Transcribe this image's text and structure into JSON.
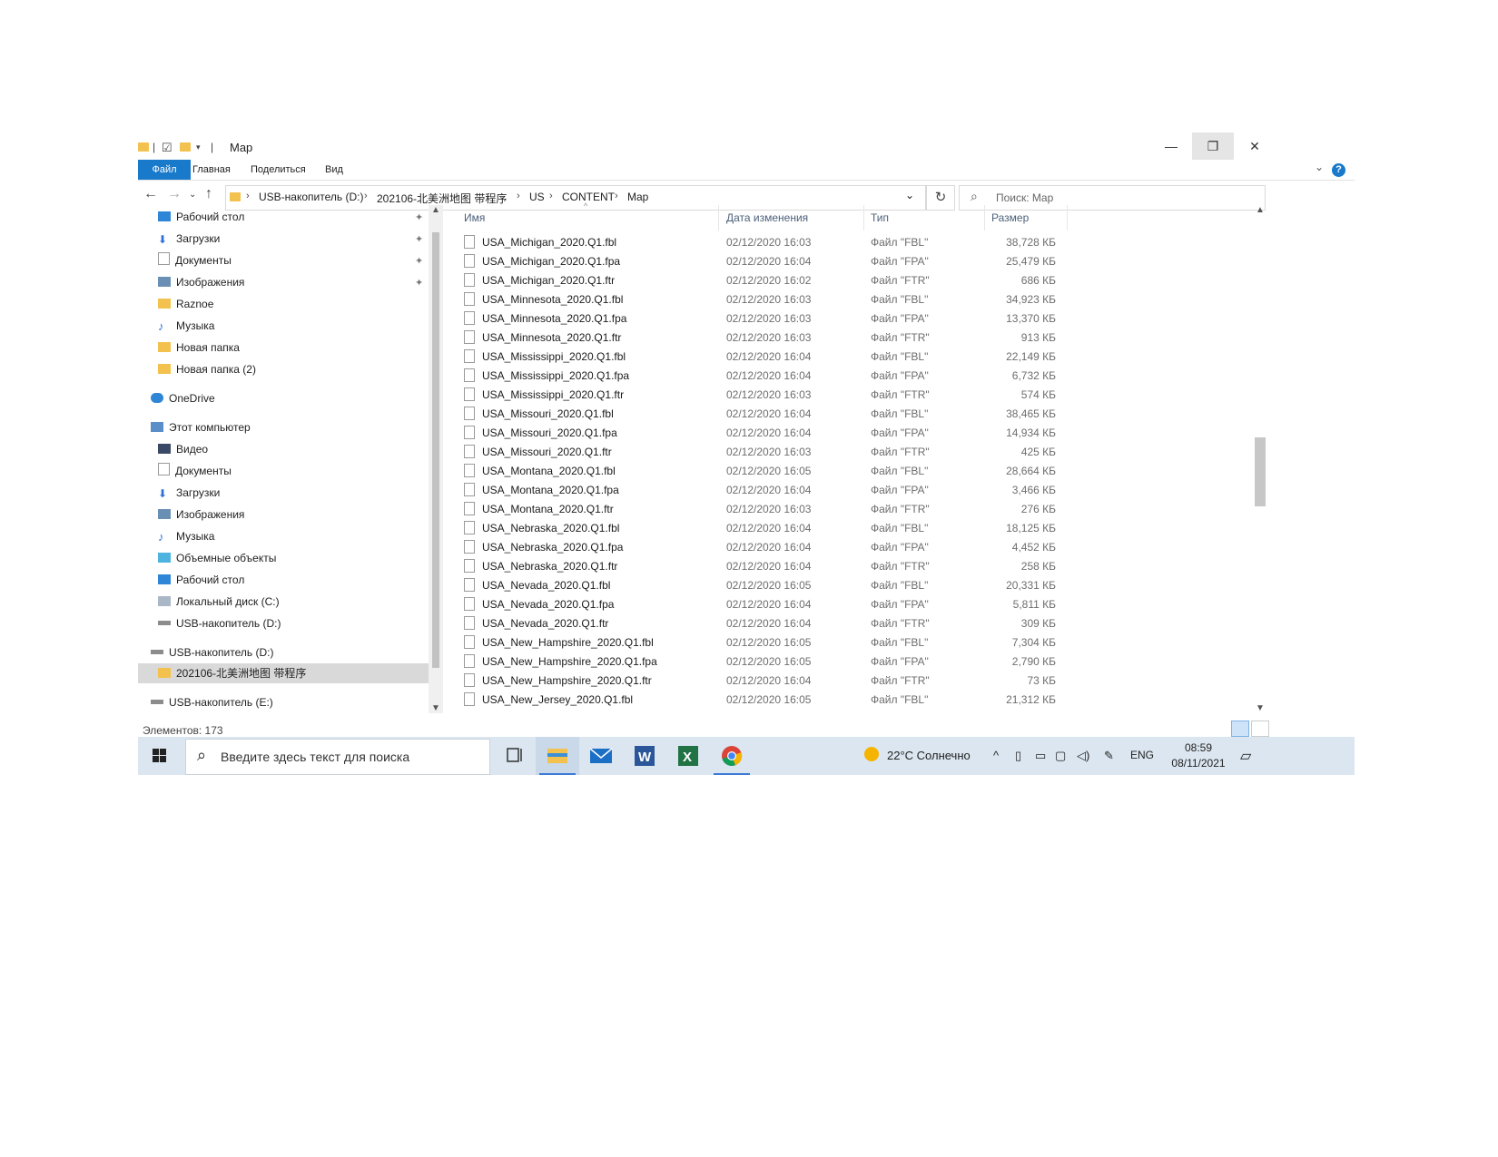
{
  "window": {
    "title": "Map",
    "buttons": {
      "minimize": "—",
      "restore": "❐",
      "close": "✕"
    }
  },
  "ribbon": {
    "tabs": [
      "Файл",
      "Главная",
      "Поделиться",
      "Вид"
    ],
    "help": "?"
  },
  "address": {
    "crumbs": [
      "USB-накопитель (D:)",
      "202106-北美洲地图 带程序",
      "US",
      "CONTENT",
      "Map"
    ]
  },
  "search": {
    "placeholder": "Поиск: Map"
  },
  "nav": {
    "quick_access": [
      {
        "label": "Рабочий стол",
        "icon": "desktop-icon",
        "pinned": true
      },
      {
        "label": "Загрузки",
        "icon": "download-icon",
        "pinned": true
      },
      {
        "label": "Документы",
        "icon": "documents-icon",
        "pinned": true
      },
      {
        "label": "Изображения",
        "icon": "pictures-icon",
        "pinned": true
      },
      {
        "label": "Raznoe",
        "icon": "folder-icon",
        "pinned": false
      },
      {
        "label": "Музыка",
        "icon": "music-icon",
        "pinned": false
      },
      {
        "label": "Новая папка",
        "icon": "folder-icon",
        "pinned": false
      },
      {
        "label": "Новая папка (2)",
        "icon": "folder-icon",
        "pinned": false
      }
    ],
    "onedrive": "OneDrive",
    "this_pc": "Этот компьютер",
    "pc_items": [
      {
        "label": "Видео",
        "icon": "video-icon"
      },
      {
        "label": "Документы",
        "icon": "documents-icon"
      },
      {
        "label": "Загрузки",
        "icon": "download-icon"
      },
      {
        "label": "Изображения",
        "icon": "pictures-icon"
      },
      {
        "label": "Музыка",
        "icon": "music-icon"
      },
      {
        "label": "Объемные объекты",
        "icon": "3d-objects-icon"
      },
      {
        "label": "Рабочий стол",
        "icon": "desktop-icon"
      },
      {
        "label": "Локальный диск (C:)",
        "icon": "disk-icon"
      },
      {
        "label": "USB-накопитель (D:)",
        "icon": "usb-drive-icon"
      }
    ],
    "usb_d": "USB-накопитель (D:)",
    "usb_d_child": "202106-北美洲地图 带程序",
    "usb_e": "USB-накопитель (E:)"
  },
  "list": {
    "columns": {
      "name": "Имя",
      "date": "Дата изменения",
      "type": "Тип",
      "size": "Размер"
    },
    "rows": [
      {
        "name": "USA_Michigan_2020.Q1.fbl",
        "date": "02/12/2020 16:03",
        "type": "Файл \"FBL\"",
        "size": "38,728 КБ"
      },
      {
        "name": "USA_Michigan_2020.Q1.fpa",
        "date": "02/12/2020 16:04",
        "type": "Файл \"FPA\"",
        "size": "25,479 КБ"
      },
      {
        "name": "USA_Michigan_2020.Q1.ftr",
        "date": "02/12/2020 16:02",
        "type": "Файл \"FTR\"",
        "size": "686 КБ"
      },
      {
        "name": "USA_Minnesota_2020.Q1.fbl",
        "date": "02/12/2020 16:03",
        "type": "Файл \"FBL\"",
        "size": "34,923 КБ"
      },
      {
        "name": "USA_Minnesota_2020.Q1.fpa",
        "date": "02/12/2020 16:03",
        "type": "Файл \"FPA\"",
        "size": "13,370 КБ"
      },
      {
        "name": "USA_Minnesota_2020.Q1.ftr",
        "date": "02/12/2020 16:03",
        "type": "Файл \"FTR\"",
        "size": "913 КБ"
      },
      {
        "name": "USA_Mississippi_2020.Q1.fbl",
        "date": "02/12/2020 16:04",
        "type": "Файл \"FBL\"",
        "size": "22,149 КБ"
      },
      {
        "name": "USA_Mississippi_2020.Q1.fpa",
        "date": "02/12/2020 16:04",
        "type": "Файл \"FPA\"",
        "size": "6,732 КБ"
      },
      {
        "name": "USA_Mississippi_2020.Q1.ftr",
        "date": "02/12/2020 16:03",
        "type": "Файл \"FTR\"",
        "size": "574 КБ"
      },
      {
        "name": "USA_Missouri_2020.Q1.fbl",
        "date": "02/12/2020 16:04",
        "type": "Файл \"FBL\"",
        "size": "38,465 КБ"
      },
      {
        "name": "USA_Missouri_2020.Q1.fpa",
        "date": "02/12/2020 16:04",
        "type": "Файл \"FPA\"",
        "size": "14,934 КБ"
      },
      {
        "name": "USA_Missouri_2020.Q1.ftr",
        "date": "02/12/2020 16:03",
        "type": "Файл \"FTR\"",
        "size": "425 КБ"
      },
      {
        "name": "USA_Montana_2020.Q1.fbl",
        "date": "02/12/2020 16:05",
        "type": "Файл \"FBL\"",
        "size": "28,664 КБ"
      },
      {
        "name": "USA_Montana_2020.Q1.fpa",
        "date": "02/12/2020 16:04",
        "type": "Файл \"FPA\"",
        "size": "3,466 КБ"
      },
      {
        "name": "USA_Montana_2020.Q1.ftr",
        "date": "02/12/2020 16:03",
        "type": "Файл \"FTR\"",
        "size": "276 КБ"
      },
      {
        "name": "USA_Nebraska_2020.Q1.fbl",
        "date": "02/12/2020 16:04",
        "type": "Файл \"FBL\"",
        "size": "18,125 КБ"
      },
      {
        "name": "USA_Nebraska_2020.Q1.fpa",
        "date": "02/12/2020 16:04",
        "type": "Файл \"FPA\"",
        "size": "4,452 КБ"
      },
      {
        "name": "USA_Nebraska_2020.Q1.ftr",
        "date": "02/12/2020 16:04",
        "type": "Файл \"FTR\"",
        "size": "258 КБ"
      },
      {
        "name": "USA_Nevada_2020.Q1.fbl",
        "date": "02/12/2020 16:05",
        "type": "Файл \"FBL\"",
        "size": "20,331 КБ"
      },
      {
        "name": "USA_Nevada_2020.Q1.fpa",
        "date": "02/12/2020 16:04",
        "type": "Файл \"FPA\"",
        "size": "5,811 КБ"
      },
      {
        "name": "USA_Nevada_2020.Q1.ftr",
        "date": "02/12/2020 16:04",
        "type": "Файл \"FTR\"",
        "size": "309 КБ"
      },
      {
        "name": "USA_New_Hampshire_2020.Q1.fbl",
        "date": "02/12/2020 16:05",
        "type": "Файл \"FBL\"",
        "size": "7,304 КБ"
      },
      {
        "name": "USA_New_Hampshire_2020.Q1.fpa",
        "date": "02/12/2020 16:05",
        "type": "Файл \"FPA\"",
        "size": "2,790 КБ"
      },
      {
        "name": "USA_New_Hampshire_2020.Q1.ftr",
        "date": "02/12/2020 16:04",
        "type": "Файл \"FTR\"",
        "size": "73 КБ"
      },
      {
        "name": "USA_New_Jersey_2020.Q1.fbl",
        "date": "02/12/2020 16:05",
        "type": "Файл \"FBL\"",
        "size": "21,312 КБ"
      }
    ]
  },
  "status": {
    "items": "Элементов: 173"
  },
  "taskbar": {
    "search_placeholder": "Введите здесь текст для поиска",
    "weather": "22°C  Солнечно",
    "lang": "ENG",
    "time": "08:59",
    "date": "08/11/2021"
  },
  "colors": {
    "accent": "#1979ca",
    "taskbar": "#dbe6f0",
    "folder": "#f2c14e"
  }
}
